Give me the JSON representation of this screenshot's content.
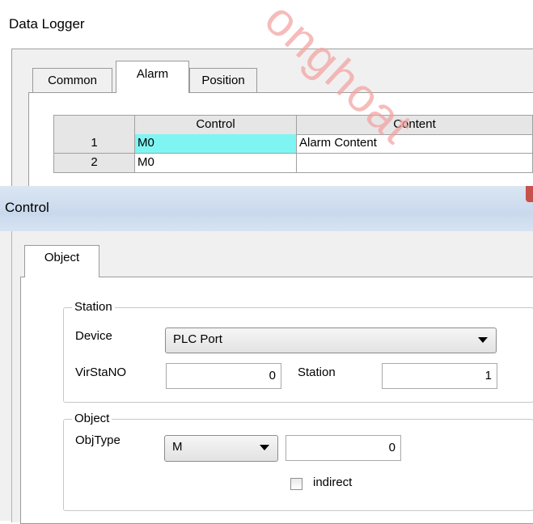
{
  "data_logger": {
    "title": "Data Logger",
    "tabs": [
      {
        "label": "Common"
      },
      {
        "label": "Alarm"
      },
      {
        "label": "Position"
      }
    ],
    "table": {
      "headers": [
        "",
        "Control",
        "Content"
      ],
      "rows": [
        {
          "index": "1",
          "control": "M0",
          "content": "Alarm Content"
        },
        {
          "index": "2",
          "control": "M0",
          "content": ""
        }
      ]
    }
  },
  "control_dialog": {
    "title": "Control",
    "tabs": [
      {
        "label": "Object"
      }
    ],
    "station_group": {
      "legend": "Station",
      "device_label": "Device",
      "device_value": "PLC Port",
      "virstano_label": "VirStaNO",
      "virstano_value": "0",
      "station_label": "Station",
      "station_value": "1"
    },
    "object_group": {
      "legend": "Object",
      "objtype_label": "ObjType",
      "objtype_value": "M",
      "address_value": "0",
      "indirect_label": "indirect",
      "indirect_checked": false
    }
  },
  "colors": {
    "selected_cell": "#7ff5f3",
    "watermark": "#f2a09e"
  }
}
